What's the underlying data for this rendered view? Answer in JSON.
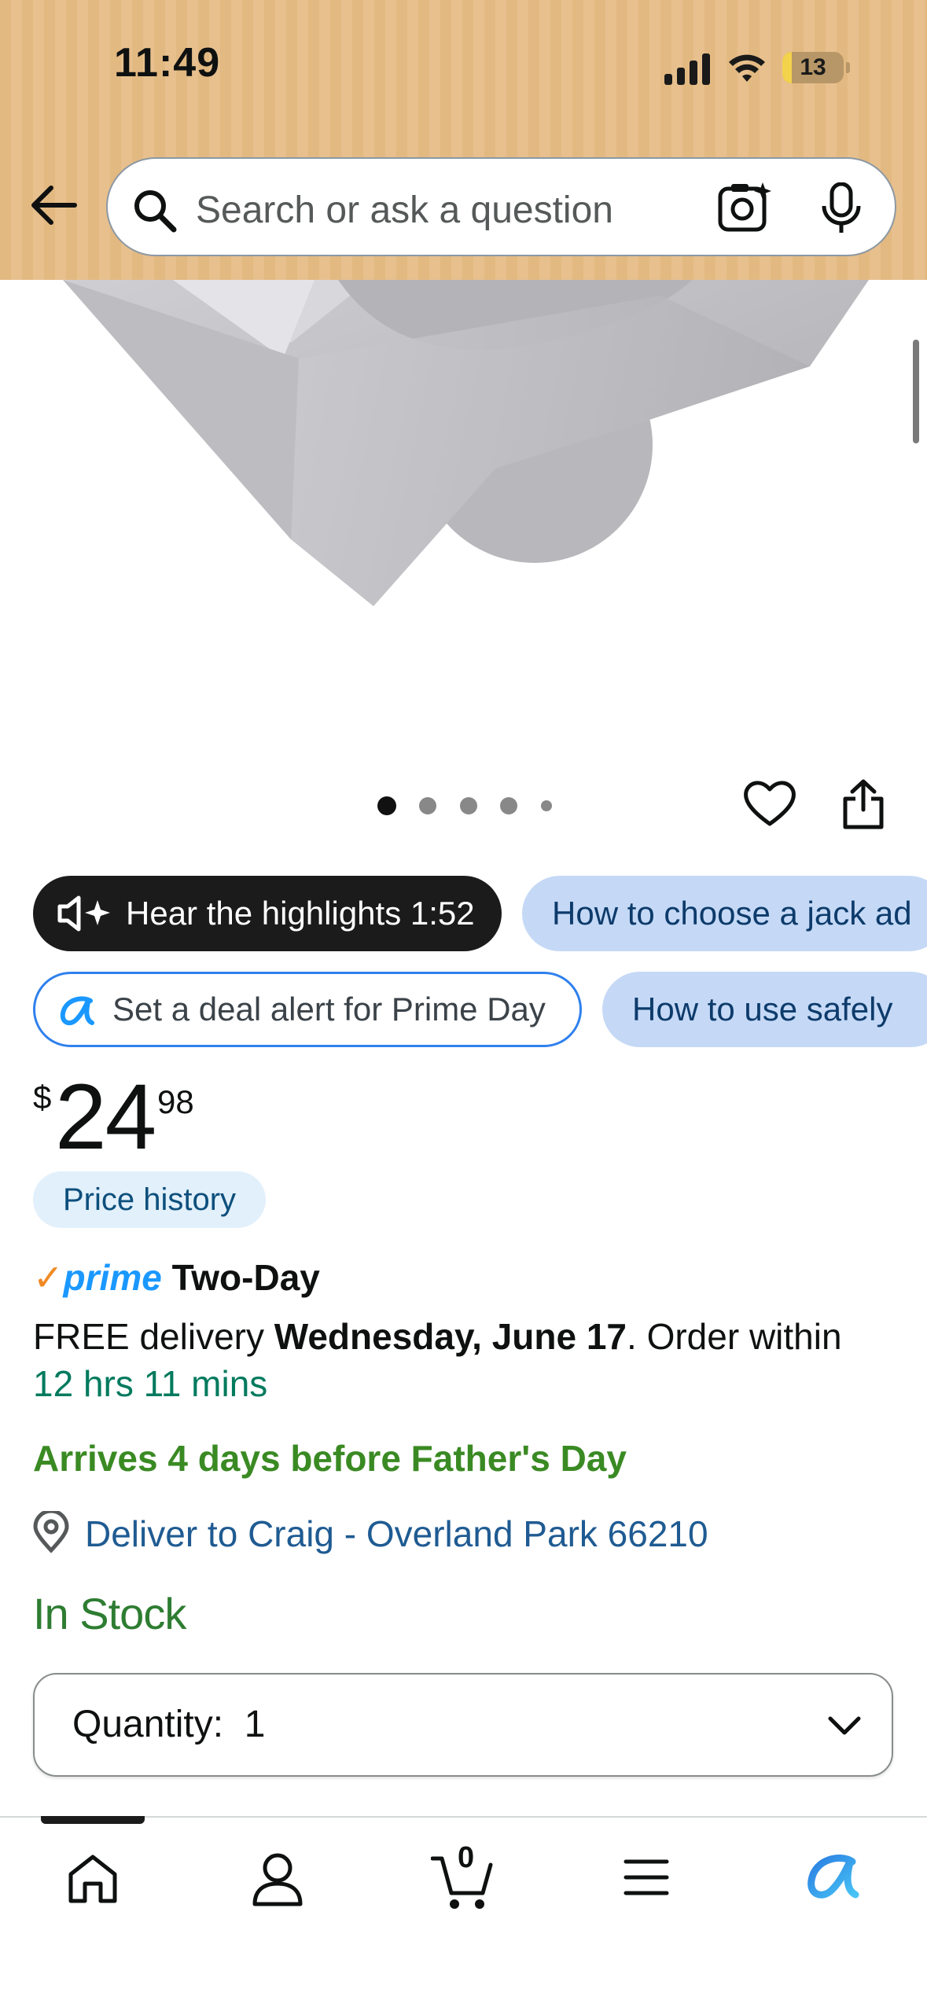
{
  "status_bar": {
    "time": "11:49",
    "battery": "13"
  },
  "search": {
    "placeholder": "Search or ask a question"
  },
  "gallery": {
    "image_count": 5,
    "active_index": 0
  },
  "chips": {
    "hear_highlights": "Hear the highlights 1:52",
    "how_to_choose": "How to choose a jack ad",
    "deal_alert": "Set a deal alert for Prime Day",
    "how_to_use": "How to use safely"
  },
  "price": {
    "currency": "$",
    "whole": "24",
    "fraction": "98",
    "history_label": "Price history"
  },
  "delivery": {
    "prime_check": "✓",
    "prime_word": "prime",
    "prime_speed": "Two-Day",
    "free_prefix": "FREE delivery ",
    "date": "Wednesday, June 17",
    "order_within": ". Order within",
    "countdown": "12 hrs 11 mins",
    "arrives_note": "Arrives 4 days before Father's Day",
    "deliver_to": "Deliver to Craig - Overland Park 66210"
  },
  "stock_status": "In Stock",
  "quantity": {
    "label": "Quantity:",
    "value": "1"
  },
  "colors": {
    "header": "#e3b982",
    "prime_blue": "#1a98ff",
    "stock_green": "#2e7d32",
    "link_blue": "#1f5b92"
  },
  "tab_bar": {
    "items": [
      "home-icon",
      "account-icon",
      "cart-icon",
      "menu-icon",
      "rufus-icon"
    ],
    "cart_count": "0"
  }
}
